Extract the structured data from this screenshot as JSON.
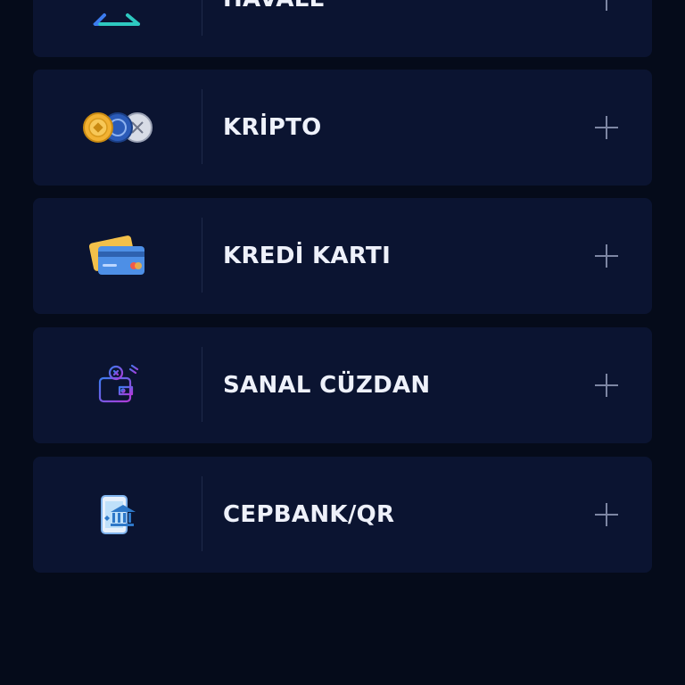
{
  "methods": [
    {
      "label": "HAVALE",
      "icon": "transfer-arrows-icon",
      "action_icon": "plus-icon"
    },
    {
      "label": "KRİPTO",
      "icon": "crypto-coins-icon",
      "action_icon": "plus-icon"
    },
    {
      "label": "KREDİ KARTI",
      "icon": "credit-card-icon",
      "action_icon": "plus-icon"
    },
    {
      "label": "SANAL CÜZDAN",
      "icon": "wallet-icon",
      "action_icon": "plus-icon"
    },
    {
      "label": "CEPBANK/QR",
      "icon": "mobile-bank-icon",
      "action_icon": "plus-icon"
    }
  ],
  "colors": {
    "background": "#050b1a",
    "card": "#0b1431",
    "text": "#eef1fa",
    "plus": "#7d86a3"
  }
}
